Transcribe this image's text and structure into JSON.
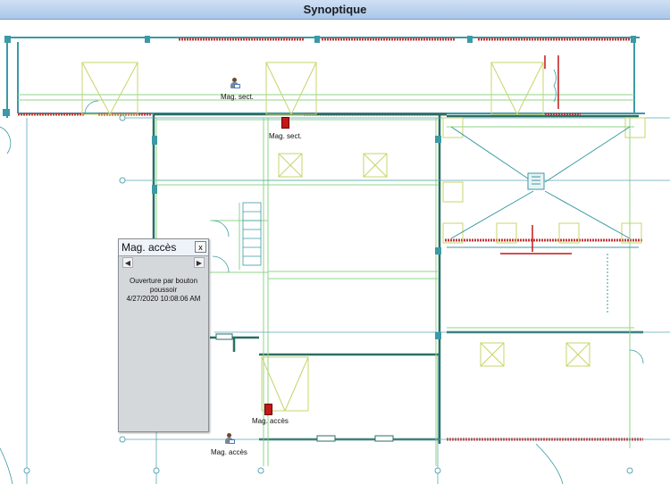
{
  "window": {
    "title": "Synoptique"
  },
  "markers": {
    "reader_top": "Mag. sect.",
    "door_top": "Mag. sect.",
    "door_bottom": "Mag. accès",
    "reader_bottom": "Mag. accès"
  },
  "popup": {
    "title": "Mag. accès",
    "close_glyph": "x",
    "prev_glyph": "◀",
    "next_glyph": "▶",
    "message_line1": "Ouverture par bouton",
    "message_line2": "poussoir",
    "timestamp": "4/27/2020 10:08:06 AM"
  },
  "colors": {
    "wall_teal": "#3b9aa6",
    "line_green": "#8fd68a",
    "fixture_yellow": "#c8d469",
    "door_red": "#c21818",
    "title_blue": "#b3cdee"
  }
}
